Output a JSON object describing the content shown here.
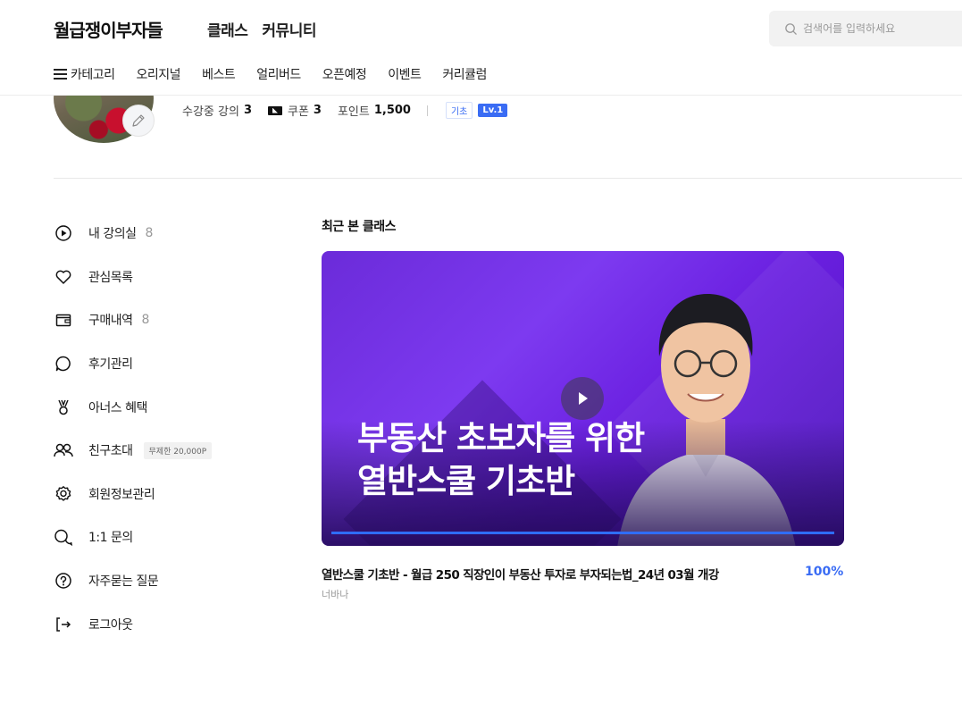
{
  "header": {
    "logo": "월급쟁이부자들",
    "nav": [
      "클래스",
      "커뮤니티"
    ],
    "search_placeholder": "검색어를 입력하세요"
  },
  "subnav": {
    "category": "카테고리",
    "items": [
      "오리지널",
      "베스트",
      "얼리버드",
      "오픈예정",
      "이벤트",
      "커리큘럼"
    ]
  },
  "profile": {
    "in_progress_label": "수강중 강의",
    "in_progress_count": "3",
    "coupon_label": "쿠폰",
    "coupon_count": "3",
    "point_label": "포인트",
    "point_value": "1,500",
    "grade_badge": "기초",
    "level_badge": "Lv.1"
  },
  "menu": [
    {
      "label": "내 강의실",
      "count": "8",
      "icon": "play-circle-icon"
    },
    {
      "label": "관심목록",
      "icon": "heart-icon"
    },
    {
      "label": "구매내역",
      "count": "8",
      "icon": "wallet-icon"
    },
    {
      "label": "후기관리",
      "icon": "speech-bubble-icon"
    },
    {
      "label": "아너스 혜택",
      "icon": "medal-icon"
    },
    {
      "label": "친구초대",
      "promo": "무제한 20,000P",
      "icon": "users-icon"
    },
    {
      "label": "회원정보관리",
      "icon": "gear-icon"
    },
    {
      "label": "1:1 문의",
      "icon": "chat-bubbles-icon"
    },
    {
      "label": "자주묻는 질문",
      "icon": "question-circle-icon"
    },
    {
      "label": "로그아웃",
      "icon": "logout-icon"
    }
  ],
  "recent": {
    "section_title": "최근 본 클래스",
    "thumbnail_line1": "부동산 초보자를 위한",
    "thumbnail_line2": "열반스쿨 기초반",
    "course_title": "열반스쿨 기초반 - 월급 250 직장인이 부동산 투자로 부자되는법_24년 03월 개강",
    "progress_label": "100%",
    "progress": 1.0,
    "author": "너바나"
  },
  "colors": {
    "accent": "#3a6cf4",
    "thumbnail_purple": "#7d3af0"
  }
}
